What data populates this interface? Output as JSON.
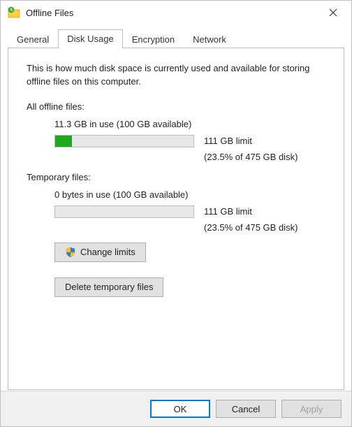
{
  "window": {
    "title": "Offline Files"
  },
  "tabs": {
    "general": "General",
    "disk_usage": "Disk Usage",
    "encryption": "Encryption",
    "network": "Network",
    "active": "disk_usage"
  },
  "content": {
    "description": "This is how much disk space is currently used and available for storing offline files on this computer.",
    "all_offline": {
      "label": "All offline files:",
      "usage_line": "11.3 GB in use (100 GB available)",
      "progress_percent": 12,
      "limit_text": "111 GB limit",
      "disk_pct": "(23.5% of 475 GB disk)"
    },
    "temporary": {
      "label": "Temporary files:",
      "usage_line": "0 bytes in use (100 GB available)",
      "progress_percent": 0,
      "limit_text": "111 GB limit",
      "disk_pct": "(23.5% of 475 GB disk)"
    },
    "change_limits_label": "Change limits",
    "delete_temp_label": "Delete temporary files"
  },
  "buttons": {
    "ok": "OK",
    "cancel": "Cancel",
    "apply": "Apply"
  }
}
